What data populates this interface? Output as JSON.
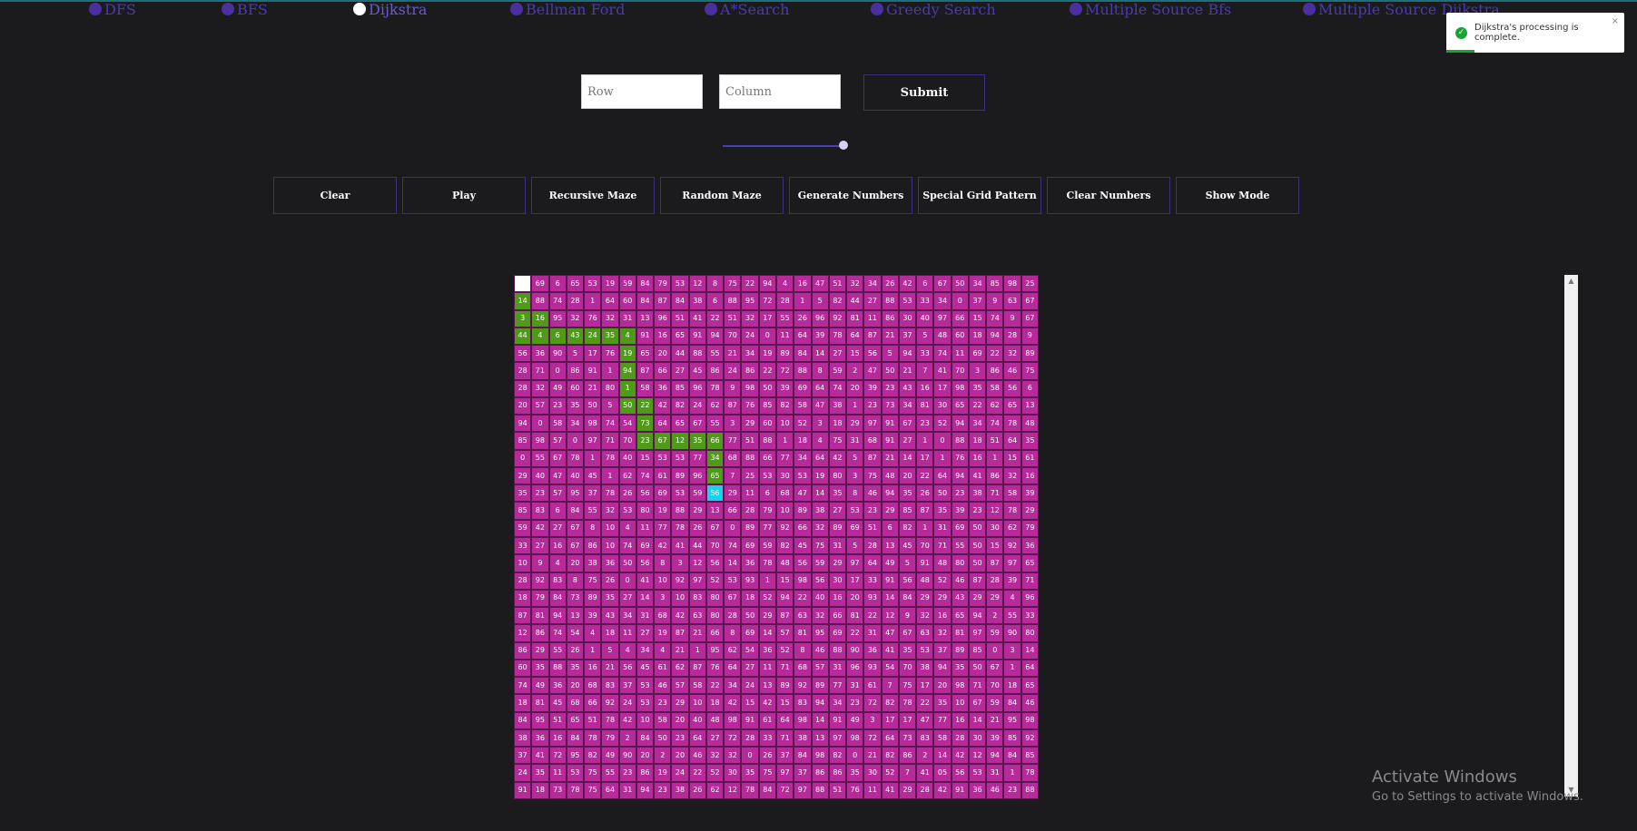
{
  "algorithms": [
    {
      "label": "DFS",
      "active": false
    },
    {
      "label": "BFS",
      "active": false
    },
    {
      "label": "Dijkstra",
      "active": true
    },
    {
      "label": "Bellman Ford",
      "active": false
    },
    {
      "label": "A*Search",
      "active": false
    },
    {
      "label": "Greedy Search",
      "active": false
    },
    {
      "label": "Multiple Source Bfs",
      "active": false
    },
    {
      "label": "Multiple Source Dijkstra",
      "active": false
    }
  ],
  "inputs": {
    "row_placeholder": "Row",
    "column_placeholder": "Column",
    "submit_label": "Submit"
  },
  "controls": [
    "Clear",
    "Play",
    "Recursive Maze",
    "Random Maze",
    "Generate Numbers",
    "Special Grid Pattern",
    "Clear Numbers",
    "Show Mode"
  ],
  "toast": {
    "message": "Dijkstra's processing is complete.",
    "close": "×",
    "icon": "check-circle-icon"
  },
  "watermark": {
    "title": "Activate Windows",
    "subtitle": "Go to Settings to activate Windows."
  },
  "colors": {
    "cell": "#b72a9a",
    "path": "#4f9a18",
    "start": "#ffffff",
    "target": "#16d4f0",
    "accent": "#4a2f9e"
  },
  "grid": {
    "start": [
      0,
      0
    ],
    "target": [
      12,
      11
    ],
    "path": [
      [
        1,
        0
      ],
      [
        2,
        0
      ],
      [
        2,
        1
      ],
      [
        3,
        0
      ],
      [
        3,
        1
      ],
      [
        3,
        2
      ],
      [
        3,
        3
      ],
      [
        3,
        4
      ],
      [
        3,
        5
      ],
      [
        3,
        6
      ],
      [
        4,
        6
      ],
      [
        5,
        6
      ],
      [
        6,
        6
      ],
      [
        7,
        6
      ],
      [
        7,
        7
      ],
      [
        8,
        7
      ],
      [
        9,
        7
      ],
      [
        9,
        8
      ],
      [
        9,
        9
      ],
      [
        9,
        10
      ],
      [
        9,
        11
      ],
      [
        10,
        11
      ],
      [
        11,
        11
      ]
    ],
    "rows": [
      [
        "",
        "69",
        "6",
        "65",
        "53",
        "19",
        "59",
        "84",
        "79",
        "53",
        "12",
        "8",
        "75",
        "22",
        "94",
        "4",
        "16",
        "47",
        "51",
        "32",
        "34",
        "26",
        "42",
        "6",
        "67",
        "50",
        "34",
        "85",
        "98",
        "25"
      ],
      [
        "14",
        "88",
        "74",
        "28",
        "1",
        "64",
        "60",
        "84",
        "87",
        "84",
        "38",
        "6",
        "88",
        "95",
        "72",
        "28",
        "1",
        "5",
        "82",
        "44",
        "27",
        "88",
        "53",
        "33",
        "34",
        "0",
        "37",
        "9",
        "63",
        "67"
      ],
      [
        "3",
        "16",
        "95",
        "32",
        "76",
        "32",
        "31",
        "13",
        "96",
        "51",
        "41",
        "22",
        "51",
        "32",
        "17",
        "55",
        "26",
        "96",
        "92",
        "81",
        "11",
        "86",
        "30",
        "40",
        "97",
        "66",
        "15",
        "74",
        "9",
        "67"
      ],
      [
        "44",
        "4",
        "6",
        "43",
        "24",
        "35",
        "4",
        "91",
        "16",
        "65",
        "91",
        "94",
        "70",
        "24",
        "0",
        "11",
        "64",
        "39",
        "78",
        "64",
        "87",
        "21",
        "37",
        "5",
        "48",
        "60",
        "18",
        "94",
        "28",
        "9"
      ],
      [
        "56",
        "36",
        "90",
        "5",
        "17",
        "76",
        "19",
        "65",
        "20",
        "44",
        "88",
        "55",
        "21",
        "34",
        "19",
        "89",
        "84",
        "14",
        "27",
        "15",
        "56",
        "5",
        "94",
        "33",
        "74",
        "11",
        "69",
        "22",
        "32",
        "89"
      ],
      [
        "28",
        "71",
        "0",
        "86",
        "91",
        "1",
        "94",
        "87",
        "66",
        "27",
        "45",
        "86",
        "24",
        "86",
        "22",
        "72",
        "88",
        "8",
        "59",
        "2",
        "47",
        "50",
        "21",
        "7",
        "41",
        "70",
        "3",
        "86",
        "46",
        "75"
      ],
      [
        "28",
        "32",
        "49",
        "60",
        "21",
        "80",
        "1",
        "58",
        "36",
        "85",
        "96",
        "78",
        "9",
        "98",
        "50",
        "39",
        "69",
        "64",
        "74",
        "20",
        "39",
        "23",
        "43",
        "16",
        "17",
        "98",
        "35",
        "58",
        "56",
        "6"
      ],
      [
        "20",
        "57",
        "23",
        "35",
        "50",
        "5",
        "50",
        "22",
        "42",
        "82",
        "24",
        "62",
        "87",
        "76",
        "85",
        "82",
        "58",
        "47",
        "38",
        "1",
        "23",
        "73",
        "34",
        "81",
        "30",
        "65",
        "22",
        "62",
        "65",
        "13"
      ],
      [
        "94",
        "0",
        "58",
        "34",
        "98",
        "74",
        "54",
        "73",
        "64",
        "65",
        "67",
        "55",
        "3",
        "29",
        "60",
        "10",
        "52",
        "3",
        "18",
        "29",
        "97",
        "91",
        "67",
        "23",
        "52",
        "94",
        "34",
        "74",
        "78",
        "48"
      ],
      [
        "85",
        "98",
        "57",
        "0",
        "97",
        "71",
        "70",
        "23",
        "67",
        "12",
        "35",
        "66",
        "77",
        "51",
        "88",
        "1",
        "18",
        "4",
        "75",
        "31",
        "68",
        "91",
        "27",
        "1",
        "0",
        "88",
        "18",
        "51",
        "64",
        "35"
      ],
      [
        "0",
        "55",
        "67",
        "78",
        "1",
        "78",
        "40",
        "15",
        "53",
        "53",
        "77",
        "34",
        "68",
        "88",
        "66",
        "77",
        "34",
        "64",
        "42",
        "5",
        "87",
        "21",
        "14",
        "17",
        "1",
        "76",
        "16",
        "1",
        "15",
        "61"
      ],
      [
        "29",
        "40",
        "47",
        "40",
        "45",
        "1",
        "62",
        "74",
        "61",
        "89",
        "96",
        "65",
        "7",
        "25",
        "53",
        "30",
        "53",
        "19",
        "80",
        "3",
        "75",
        "48",
        "20",
        "22",
        "64",
        "94",
        "41",
        "86",
        "32",
        "16"
      ],
      [
        "35",
        "23",
        "57",
        "95",
        "37",
        "78",
        "26",
        "56",
        "69",
        "53",
        "59",
        "56",
        "29",
        "11",
        "6",
        "68",
        "47",
        "14",
        "35",
        "8",
        "46",
        "94",
        "35",
        "26",
        "50",
        "23",
        "38",
        "71",
        "58",
        "39"
      ],
      [
        "85",
        "83",
        "6",
        "84",
        "55",
        "32",
        "53",
        "80",
        "19",
        "88",
        "29",
        "13",
        "66",
        "28",
        "79",
        "10",
        "89",
        "38",
        "27",
        "53",
        "23",
        "29",
        "85",
        "87",
        "35",
        "39",
        "23",
        "12",
        "78",
        "29"
      ],
      [
        "59",
        "42",
        "27",
        "67",
        "8",
        "10",
        "4",
        "11",
        "77",
        "78",
        "26",
        "67",
        "0",
        "89",
        "77",
        "92",
        "66",
        "32",
        "89",
        "69",
        "51",
        "6",
        "82",
        "1",
        "31",
        "69",
        "50",
        "30",
        "62",
        "79"
      ],
      [
        "33",
        "27",
        "16",
        "67",
        "86",
        "10",
        "74",
        "69",
        "42",
        "41",
        "44",
        "70",
        "74",
        "69",
        "59",
        "82",
        "45",
        "75",
        "31",
        "5",
        "28",
        "13",
        "45",
        "70",
        "71",
        "55",
        "50",
        "15",
        "92",
        "36"
      ],
      [
        "10",
        "9",
        "4",
        "20",
        "38",
        "36",
        "50",
        "56",
        "8",
        "3",
        "12",
        "56",
        "14",
        "36",
        "78",
        "48",
        "56",
        "59",
        "29",
        "97",
        "64",
        "49",
        "5",
        "91",
        "48",
        "80",
        "50",
        "87",
        "97",
        "65"
      ],
      [
        "28",
        "92",
        "83",
        "8",
        "75",
        "26",
        "0",
        "41",
        "10",
        "92",
        "97",
        "52",
        "53",
        "93",
        "1",
        "15",
        "98",
        "56",
        "30",
        "17",
        "33",
        "91",
        "56",
        "48",
        "52",
        "46",
        "87",
        "28",
        "39",
        "71"
      ],
      [
        "18",
        "79",
        "84",
        "73",
        "89",
        "35",
        "27",
        "14",
        "3",
        "10",
        "83",
        "80",
        "67",
        "18",
        "52",
        "94",
        "22",
        "40",
        "16",
        "20",
        "93",
        "14",
        "84",
        "29",
        "29",
        "43",
        "29",
        "29",
        "4",
        "96"
      ],
      [
        "87",
        "81",
        "94",
        "13",
        "39",
        "43",
        "34",
        "31",
        "68",
        "42",
        "63",
        "80",
        "28",
        "50",
        "29",
        "87",
        "63",
        "32",
        "66",
        "81",
        "22",
        "12",
        "9",
        "32",
        "16",
        "65",
        "94",
        "2",
        "55",
        "33"
      ],
      [
        "12",
        "86",
        "74",
        "54",
        "4",
        "18",
        "11",
        "27",
        "19",
        "87",
        "21",
        "66",
        "8",
        "69",
        "14",
        "57",
        "81",
        "95",
        "69",
        "22",
        "31",
        "47",
        "67",
        "63",
        "32",
        "81",
        "97",
        "59",
        "90",
        "80"
      ],
      [
        "86",
        "29",
        "55",
        "26",
        "1",
        "5",
        "4",
        "34",
        "4",
        "21",
        "1",
        "95",
        "62",
        "54",
        "36",
        "52",
        "8",
        "46",
        "88",
        "90",
        "36",
        "41",
        "35",
        "53",
        "37",
        "89",
        "85",
        "0",
        "3",
        "14"
      ],
      [
        "60",
        "35",
        "88",
        "35",
        "16",
        "21",
        "56",
        "45",
        "61",
        "62",
        "87",
        "76",
        "64",
        "27",
        "11",
        "71",
        "68",
        "57",
        "31",
        "96",
        "93",
        "54",
        "70",
        "38",
        "94",
        "35",
        "50",
        "67",
        "1",
        "64"
      ],
      [
        "74",
        "49",
        "36",
        "20",
        "68",
        "83",
        "37",
        "53",
        "46",
        "57",
        "58",
        "22",
        "34",
        "24",
        "13",
        "89",
        "92",
        "89",
        "77",
        "31",
        "61",
        "7",
        "75",
        "17",
        "20",
        "98",
        "71",
        "70",
        "18",
        "65"
      ],
      [
        "18",
        "81",
        "45",
        "68",
        "66",
        "92",
        "24",
        "53",
        "23",
        "29",
        "10",
        "18",
        "42",
        "15",
        "42",
        "15",
        "83",
        "94",
        "34",
        "23",
        "72",
        "82",
        "78",
        "22",
        "35",
        "10",
        "67",
        "59",
        "84",
        "46"
      ],
      [
        "84",
        "95",
        "51",
        "65",
        "51",
        "78",
        "42",
        "10",
        "58",
        "20",
        "40",
        "48",
        "98",
        "91",
        "61",
        "64",
        "98",
        "14",
        "91",
        "49",
        "3",
        "17",
        "17",
        "47",
        "77",
        "16",
        "14",
        "21",
        "95",
        "98"
      ],
      [
        "38",
        "36",
        "16",
        "84",
        "78",
        "79",
        "2",
        "84",
        "50",
        "23",
        "64",
        "27",
        "72",
        "28",
        "33",
        "71",
        "38",
        "13",
        "97",
        "98",
        "72",
        "64",
        "73",
        "83",
        "58",
        "28",
        "30",
        "39",
        "85",
        "92"
      ],
      [
        "37",
        "41",
        "72",
        "95",
        "82",
        "49",
        "90",
        "20",
        "2",
        "20",
        "46",
        "32",
        "32",
        "0",
        "26",
        "37",
        "84",
        "98",
        "82",
        "0",
        "21",
        "82",
        "86",
        "2",
        "14",
        "42",
        "12",
        "94",
        "84",
        "85"
      ],
      [
        "24",
        "35",
        "11",
        "53",
        "75",
        "55",
        "23",
        "86",
        "19",
        "24",
        "22",
        "52",
        "30",
        "35",
        "75",
        "97",
        "37",
        "86",
        "86",
        "35",
        "30",
        "52",
        "7",
        "41",
        "05",
        "56",
        "53",
        "31",
        "1",
        "78"
      ],
      [
        "91",
        "18",
        "73",
        "78",
        "75",
        "64",
        "31",
        "94",
        "23",
        "38",
        "26",
        "62",
        "12",
        "78",
        "84",
        "72",
        "97",
        "88",
        "51",
        "76",
        "11",
        "41",
        "29",
        "28",
        "42",
        "91",
        "36",
        "46",
        "23",
        "88"
      ]
    ]
  }
}
